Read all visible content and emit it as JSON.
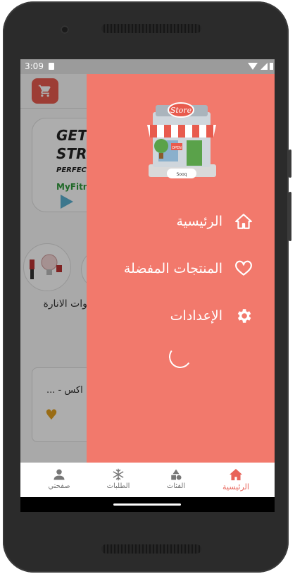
{
  "status_bar": {
    "time": "3:09"
  },
  "background": {
    "banner": {
      "line1": "GET",
      "line2": "STRO",
      "line3": "PERFECT",
      "line4": "MyFitn"
    },
    "category_label": "ادوات الانارة",
    "card_title": "اكس - ..."
  },
  "drawer": {
    "logo": {
      "sign_text": "Store",
      "open_text": "OPEN",
      "brand_text": "Sooq"
    },
    "menu": [
      {
        "label": "الرئيسية",
        "icon": "home-icon"
      },
      {
        "label": "المنتجات المفضلة",
        "icon": "heart-icon"
      },
      {
        "label": "الإعدادات",
        "icon": "gear-icon"
      }
    ]
  },
  "bottom_nav": {
    "items": [
      {
        "label": "الرئيسية",
        "icon": "home-icon",
        "active": true
      },
      {
        "label": "الفئات",
        "icon": "categories-icon",
        "active": false
      },
      {
        "label": "الطلبات",
        "icon": "snowflake-icon",
        "active": false
      },
      {
        "label": "صفحتي",
        "icon": "person-icon",
        "active": false
      }
    ]
  },
  "colors": {
    "accent": "#f2796c",
    "brand_red": "#e85b4e",
    "active_nav": "#e8645a"
  }
}
